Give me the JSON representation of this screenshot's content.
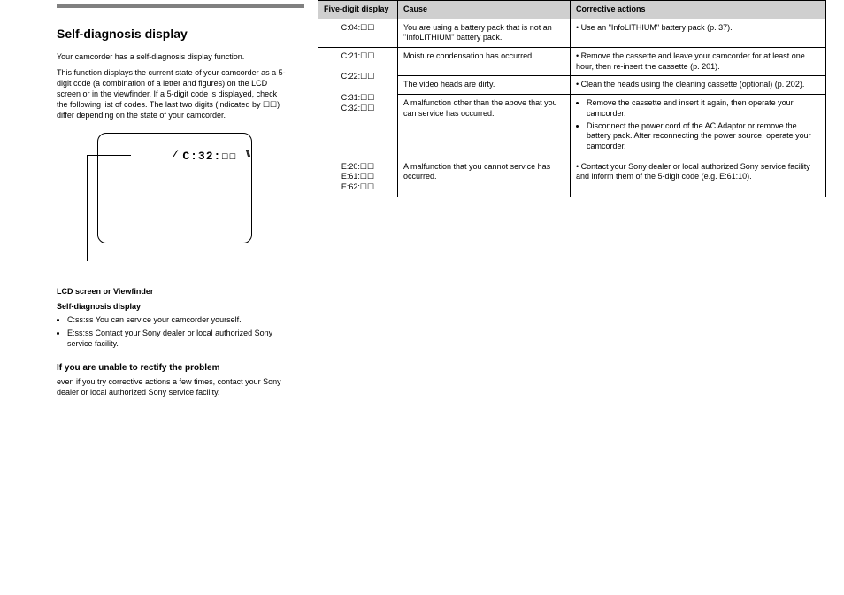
{
  "heading": "Self-diagnosis display",
  "intro1": "Your camcorder has a self-diagnosis display function.",
  "intro2_a": "This function displays the current state of your camcorder as a 5-digit code (a combination of a letter and figures) on the LCD screen or in the viewfinder. If a 5-digit code is displayed, check the following list of codes. The last two digits (indicated by ",
  "intro2_b": ") differ depending on the state of your camcorder.",
  "code_sample": "C:32:",
  "lcd_caption_title": "LCD screen or Viewfinder",
  "lcd_caption_body": "Self-diagnosis display",
  "lcd_bullets": [
    "C:ss:ss  You can service your camcorder yourself.",
    "E:ss:ss  Contact your Sony dealer or local authorized Sony service facility."
  ],
  "notes_h": "If you are unable to rectify the problem",
  "notes_body": "even if you try corrective actions a few times, contact your Sony dealer or local authorized Sony service facility.",
  "table": {
    "headers": [
      "Five-digit display",
      "Cause",
      "Corrective actions"
    ],
    "rows": [
      {
        "code": "C:04:ss",
        "rowspan": 1,
        "cause": "You are using a battery pack that is not an \"InfoLITHIUM\" battery pack.",
        "action": "Use an \"InfoLITHIUM\" battery pack (p. 37)."
      },
      {
        "code": "C:21:ss",
        "rowspan": 1,
        "cause": "Moisture condensation has occurred.",
        "action": "Remove the cassette and leave your camcorder for at least one hour, then re-insert the cassette (p. 201)."
      },
      {
        "code": "",
        "rowspan": 0,
        "cause": "The video heads are dirty.",
        "action": "Clean the heads using the cleaning cassette (optional) (p. 202)."
      },
      {
        "code": "",
        "rowspan": 0,
        "cause": "A malfunction other than the above that you can service has occurred.",
        "action_list": [
          "Remove the cassette and insert it again, then operate your camcorder.",
          "Disconnect the power cord of the AC Adaptor or remove the battery pack. After reconnecting the power source, operate your camcorder."
        ]
      },
      {
        "code": "E:20:ss\nE:61:ss\nE:62:ss",
        "rowspan": 1,
        "cause": "A malfunction that you cannot service has occurred.",
        "action": "Contact your Sony dealer or local authorized Sony service facility and inform them of the 5-digit code (e.g. E:61:10)."
      }
    ]
  },
  "squares": "ss"
}
